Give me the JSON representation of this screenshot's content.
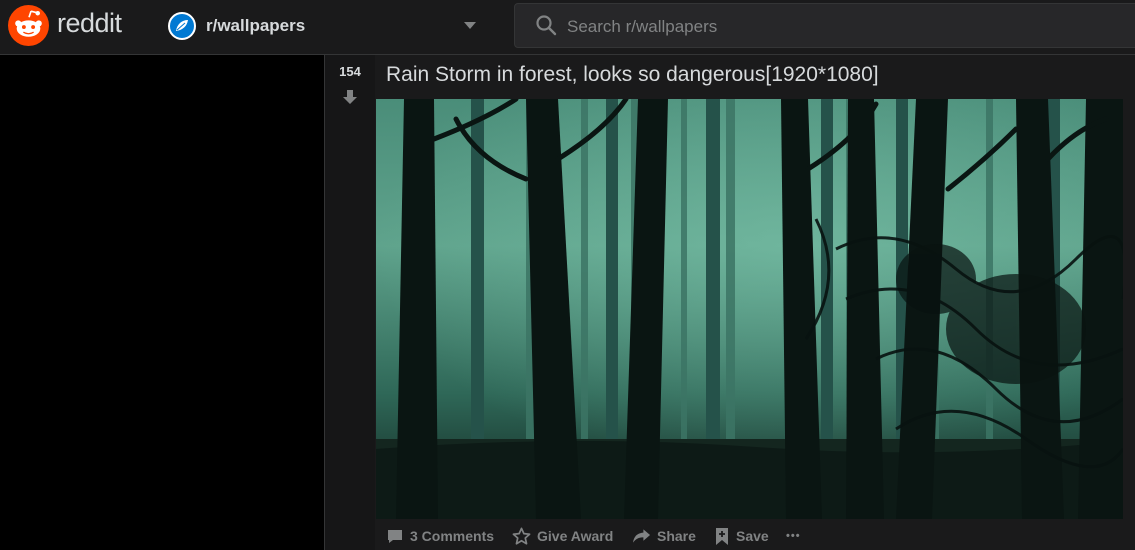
{
  "header": {
    "wordmark": "reddit",
    "community": "r/wallpapers",
    "search_placeholder": "Search r/wallpapers"
  },
  "post": {
    "score": "154",
    "title": "Rain Storm in forest, looks so dangerous[1920*1080]",
    "actions": {
      "comments": "3 Comments",
      "award": "Give Award",
      "share": "Share",
      "save": "Save",
      "more": "•••"
    }
  },
  "colors": {
    "brand": "#ff4500",
    "community_icon": "#0079d3",
    "background": "#000000",
    "surface": "#1a1a1b",
    "text": "#d7dadc",
    "muted": "#818384"
  }
}
